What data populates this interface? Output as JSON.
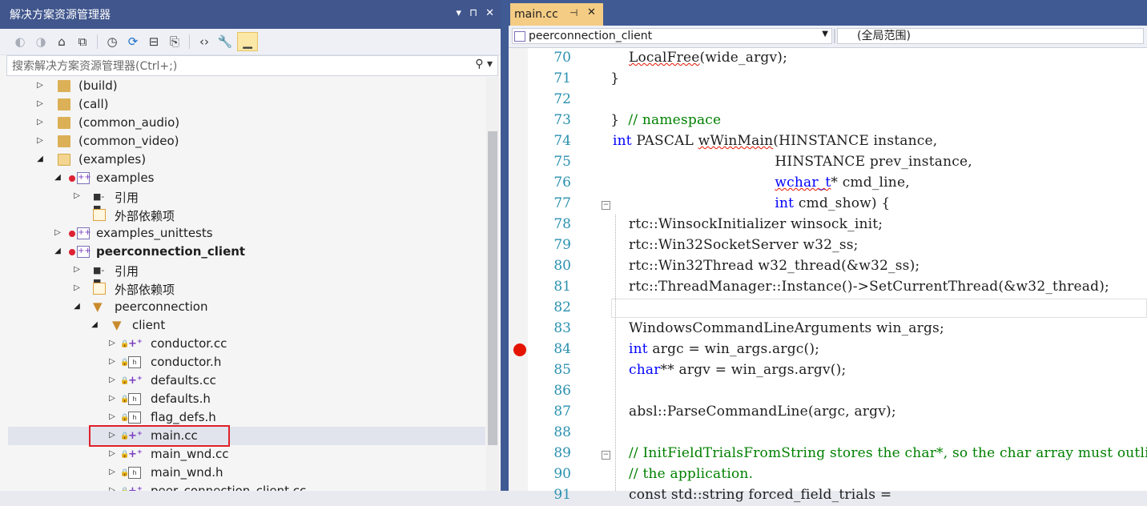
{
  "solution_explorer": {
    "title": "解决方案资源管理器",
    "title_controls": [
      "▾",
      "⊓",
      "✕"
    ],
    "search_placeholder": "搜索解决方案资源管理器(Ctrl+;)",
    "tree": [
      {
        "label": "(build)",
        "type": "folder",
        "expand": "collapsed",
        "level": 0
      },
      {
        "label": "(call)",
        "type": "folder",
        "expand": "collapsed",
        "level": 0
      },
      {
        "label": "(common_audio)",
        "type": "folder",
        "expand": "collapsed",
        "level": 0
      },
      {
        "label": "(common_video)",
        "type": "folder",
        "expand": "collapsed",
        "level": 0
      },
      {
        "label": "(examples)",
        "type": "folder-open",
        "expand": "expanded",
        "level": 0
      },
      {
        "label": "examples",
        "type": "project",
        "expand": "expanded",
        "level": 1
      },
      {
        "label": "引用",
        "type": "references",
        "expand": "collapsed",
        "level": 2
      },
      {
        "label": "外部依赖项",
        "type": "external",
        "expand": "none",
        "level": 2
      },
      {
        "label": "examples_unittests",
        "type": "project",
        "expand": "collapsed",
        "level": 1
      },
      {
        "label": "peerconnection_client",
        "type": "project",
        "expand": "expanded",
        "level": 1,
        "bold": true
      },
      {
        "label": "引用",
        "type": "references",
        "expand": "collapsed",
        "level": 2
      },
      {
        "label": "外部依赖项",
        "type": "external",
        "expand": "collapsed",
        "level": 2
      },
      {
        "label": "peerconnection",
        "type": "filter",
        "expand": "expanded",
        "level": 2
      },
      {
        "label": "client",
        "type": "filter",
        "expand": "expanded",
        "level": 3
      },
      {
        "label": "conductor.cc",
        "type": "cc",
        "expand": "collapsed",
        "level": 4
      },
      {
        "label": "conductor.h",
        "type": "h",
        "expand": "collapsed",
        "level": 4
      },
      {
        "label": "defaults.cc",
        "type": "cc",
        "expand": "collapsed",
        "level": 4
      },
      {
        "label": "defaults.h",
        "type": "h",
        "expand": "collapsed",
        "level": 4
      },
      {
        "label": "flag_defs.h",
        "type": "h",
        "expand": "collapsed",
        "level": 4
      },
      {
        "label": "main.cc",
        "type": "cc",
        "expand": "collapsed",
        "level": 4,
        "selected": true,
        "highlighted": true
      },
      {
        "label": "main_wnd.cc",
        "type": "cc",
        "expand": "collapsed",
        "level": 4
      },
      {
        "label": "main_wnd.h",
        "type": "h",
        "expand": "collapsed",
        "level": 4
      },
      {
        "label": "peer_connection_client.cc",
        "type": "cc",
        "expand": "collapsed",
        "level": 4
      }
    ]
  },
  "editor": {
    "tab_label": "main.cc",
    "tab_pin": "⊣",
    "tab_close": "✕",
    "nav_project": "peerconnection_client",
    "nav_scope": "(全局范围)",
    "lines": [
      {
        "n": "70",
        "ind": 1,
        "parts": [
          {
            "t": "LocalFree",
            "c": "squig"
          },
          {
            "t": "(wide_argv);",
            "c": ""
          }
        ]
      },
      {
        "n": "71",
        "ind": 0,
        "parts": [
          {
            "t": "}",
            "c": ""
          }
        ]
      },
      {
        "n": "72",
        "ind": 0,
        "parts": []
      },
      {
        "n": "73",
        "ind": 0,
        "parts": [
          {
            "t": "}  ",
            "c": ""
          },
          {
            "t": "// namespace",
            "c": "cm"
          }
        ]
      },
      {
        "n": "74",
        "ind": -1,
        "parts": [
          {
            "t": "int",
            "c": "kw"
          },
          {
            "t": " PASCAL ",
            "c": ""
          },
          {
            "t": "wWinMain",
            "c": "squig"
          },
          {
            "t": "(HINSTANCE instance,",
            "c": ""
          }
        ]
      },
      {
        "n": "75",
        "ind": 9,
        "parts": [
          {
            "t": "HINSTANCE prev_instance,",
            "c": ""
          }
        ]
      },
      {
        "n": "76",
        "ind": 9,
        "parts": [
          {
            "t": "wchar_t",
            "c": "kw squig"
          },
          {
            "t": "* cmd_line,",
            "c": ""
          }
        ]
      },
      {
        "n": "77",
        "ind": 9,
        "parts": [
          {
            "t": "int",
            "c": "kw"
          },
          {
            "t": " cmd_show) {",
            "c": ""
          }
        ],
        "fold": true
      },
      {
        "n": "78",
        "ind": 1,
        "parts": [
          {
            "t": "rtc::WinsockInitializer winsock_init;",
            "c": ""
          }
        ]
      },
      {
        "n": "79",
        "ind": 1,
        "parts": [
          {
            "t": "rtc::Win32SocketServer w32_ss;",
            "c": ""
          }
        ]
      },
      {
        "n": "80",
        "ind": 1,
        "parts": [
          {
            "t": "rtc::Win32Thread w32_thread(&w32_ss);",
            "c": ""
          }
        ]
      },
      {
        "n": "81",
        "ind": 1,
        "parts": [
          {
            "t": "rtc::ThreadManager::Instance()->SetCurrentThread(&w32_thread);",
            "c": ""
          }
        ]
      },
      {
        "n": "82",
        "ind": 1,
        "parts": [],
        "current": true
      },
      {
        "n": "83",
        "ind": 1,
        "parts": [
          {
            "t": "WindowsCommandLineArguments win_args;",
            "c": ""
          }
        ]
      },
      {
        "n": "84",
        "ind": 1,
        "parts": [
          {
            "t": "int",
            "c": "kw"
          },
          {
            "t": " argc = win_args.argc();",
            "c": ""
          }
        ],
        "breakpoint": true
      },
      {
        "n": "85",
        "ind": 1,
        "parts": [
          {
            "t": "char",
            "c": "kw"
          },
          {
            "t": "** argv = win_args.argv();",
            "c": ""
          }
        ]
      },
      {
        "n": "86",
        "ind": 1,
        "parts": []
      },
      {
        "n": "87",
        "ind": 1,
        "parts": [
          {
            "t": "absl::ParseCommandLine(argc, argv);",
            "c": ""
          }
        ]
      },
      {
        "n": "88",
        "ind": 1,
        "parts": []
      },
      {
        "n": "89",
        "ind": 1,
        "parts": [
          {
            "t": "// InitFieldTrialsFromString stores the char*, so the char array must outlive",
            "c": "cm"
          }
        ],
        "fold": true
      },
      {
        "n": "90",
        "ind": 1,
        "parts": [
          {
            "t": "// the application.",
            "c": "cm"
          }
        ]
      },
      {
        "n": "91",
        "ind": 1,
        "parts": [
          {
            "t": "const std::string forced_field_trials =",
            "c": ""
          }
        ]
      }
    ]
  }
}
